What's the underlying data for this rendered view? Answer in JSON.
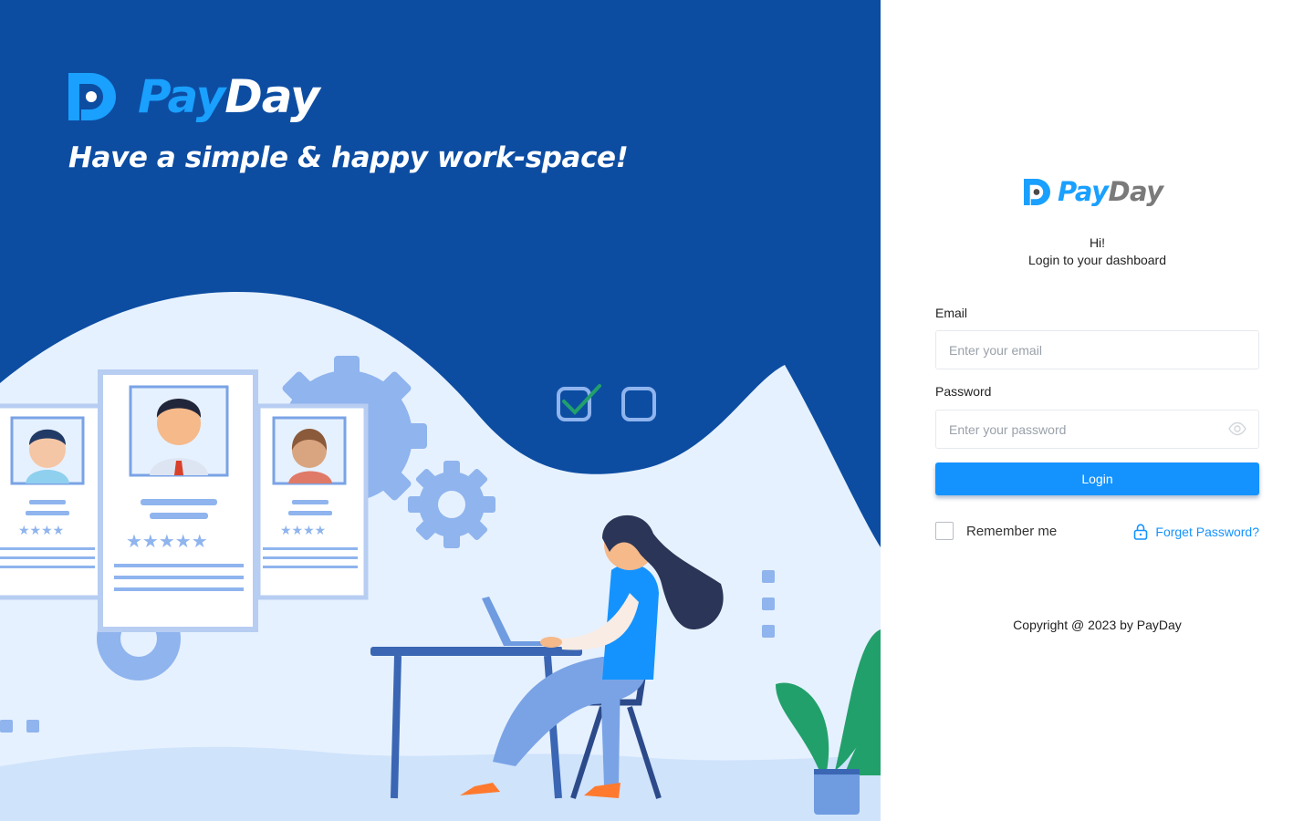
{
  "hero": {
    "logo": {
      "pay": "Pay",
      "day": "Day",
      "icon": "payday-logo-icon"
    },
    "tagline": "Have a simple & happy work-space!",
    "illustration": "workspace-illustration"
  },
  "login": {
    "logo": {
      "pay": "Pay",
      "day": "Day",
      "icon": "payday-logo-icon"
    },
    "greeting": "Hi!",
    "subtitle": "Login to your dashboard",
    "email": {
      "label": "Email",
      "placeholder": "Enter your email",
      "value": ""
    },
    "password": {
      "label": "Password",
      "placeholder": "Enter your password",
      "value": "",
      "toggle_icon": "eye-icon"
    },
    "submit_label": "Login",
    "remember": {
      "label": "Remember me",
      "checked": false
    },
    "forgot": {
      "label": "Forget Password?",
      "icon": "lock-icon"
    },
    "copyright": "Copyright @ 2023 by PayDay"
  },
  "colors": {
    "hero_bg": "#0c4da2",
    "accent": "#1493ff",
    "logo_blue": "#1aa0ff",
    "logo_gray": "#7a7a7a"
  }
}
